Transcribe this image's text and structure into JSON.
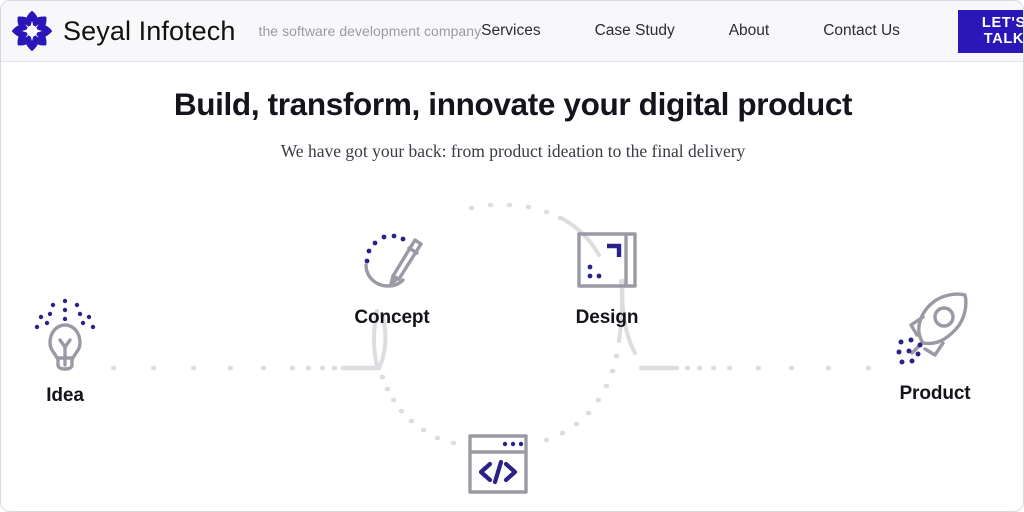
{
  "header": {
    "logo_icon": "seyal-flower-logo-icon",
    "brand_name": "Seyal Infotech",
    "tagline": "the software development company",
    "nav_items": [
      {
        "label": "Services"
      },
      {
        "label": "Case Study"
      },
      {
        "label": "About"
      },
      {
        "label": "Contact Us"
      }
    ],
    "cta_label": "LET'S TALK",
    "cta_color": "#2a17b8"
  },
  "hero": {
    "title": "Build, transform, innovate your digital product",
    "subtitle": "We have got your back: from product ideation to the final delivery"
  },
  "journey": {
    "stages": [
      {
        "id": "idea",
        "label": "Idea",
        "icon": "lightbulb-icon"
      },
      {
        "id": "concept",
        "label": "Concept",
        "icon": "pencil-icon"
      },
      {
        "id": "design",
        "label": "Design",
        "icon": "design-frame-icon"
      },
      {
        "id": "product",
        "label": "Product",
        "icon": "rocket-icon"
      }
    ],
    "code_node": {
      "icon": "code-window-icon",
      "symbol": "</>"
    },
    "accent_color": "#2a2288",
    "line_color": "#9a9aa6"
  }
}
